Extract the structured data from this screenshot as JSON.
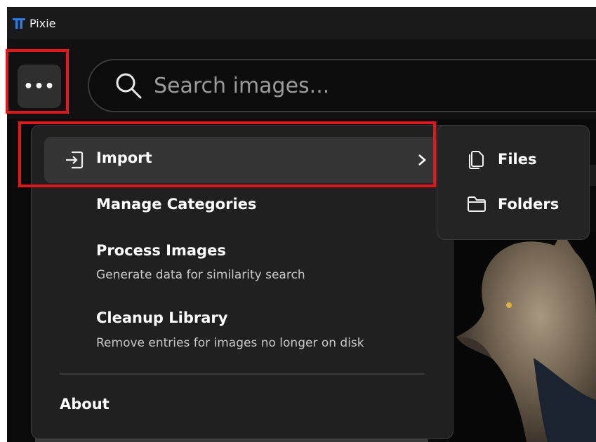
{
  "window": {
    "title": "Pixie"
  },
  "toolbar": {
    "more_label": "•••",
    "search_placeholder": "Search images..."
  },
  "menu": {
    "import_label": "Import",
    "items": [
      {
        "label": "Manage Categories"
      },
      {
        "label": "Process Images",
        "description": "Generate data for similarity search"
      },
      {
        "label": "Cleanup Library",
        "description": "Remove entries for images no longer on disk"
      }
    ],
    "about_label": "About"
  },
  "submenu": {
    "items": [
      {
        "label": "Files",
        "icon": "files-icon"
      },
      {
        "label": "Folders",
        "icon": "folder-icon"
      }
    ]
  },
  "colors": {
    "highlight": "#e4141b",
    "menu_bg": "#202020",
    "hover_bg": "#353535"
  }
}
